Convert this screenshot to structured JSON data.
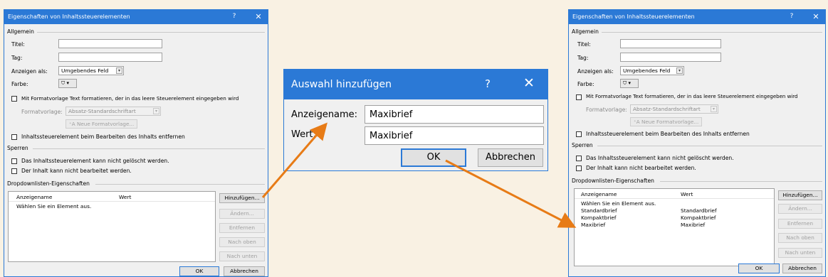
{
  "colors": {
    "background": "#f9f1e3",
    "titlebar": "#2b79d6",
    "arrow": "#e77b16"
  },
  "dialog_left": {
    "title": "Eigenschaften von Inhaltssteuerelementen",
    "help": "?",
    "close": "✕",
    "section_general": "Allgemein",
    "title_label": "Titel:",
    "tag_label": "Tag:",
    "show_as_label": "Anzeigen als:",
    "show_as_value": "Umgebendes Feld",
    "color_label": "Farbe:",
    "style_check_label": "Mit Formatvorlage Text formatieren, der in das leere Steuerelement eingegeben wird",
    "style_label": "Formatvorlage:",
    "style_value": "Absatz-Standardschriftart",
    "new_style_button": "Neue Formatvorlage...",
    "remove_check_label": "Inhaltssteuerelement beim Bearbeiten des Inhalts entfernen",
    "section_lock": "Sperren",
    "lock_delete_label": "Das Inhaltssteuerelement kann nicht gelöscht werden.",
    "lock_edit_label": "Der Inhalt kann nicht bearbeitet werden.",
    "section_dropdown": "Dropdownlisten-Eigenschaften",
    "col_display": "Anzeigename",
    "col_value": "Wert",
    "rows": [
      {
        "name": "Wählen Sie ein Element aus.",
        "value": ""
      }
    ],
    "btn_add": "Hinzufügen...",
    "btn_edit": "Ändern...",
    "btn_remove": "Entfernen",
    "btn_up": "Nach oben",
    "btn_down": "Nach unten",
    "btn_ok": "OK",
    "btn_cancel": "Abbrechen"
  },
  "dialog_middle": {
    "title": "Auswahl hinzufügen",
    "help": "?",
    "close": "✕",
    "display_name_label": "Anzeigename:",
    "display_name_value": "Maxibrief",
    "value_label": "Wert:",
    "value_value": "Maxibrief",
    "btn_ok": "OK",
    "btn_cancel": "Abbrechen"
  },
  "dialog_right": {
    "title": "Eigenschaften von Inhaltssteuerelementen",
    "help": "?",
    "close": "✕",
    "section_general": "Allgemein",
    "title_label": "Titel:",
    "tag_label": "Tag:",
    "show_as_label": "Anzeigen als:",
    "show_as_value": "Umgebendes Feld",
    "color_label": "Farbe:",
    "style_check_label": "Mit Formatvorlage Text formatieren, der in das leere Steuerelement eingegeben wird",
    "style_label": "Formatvorlage:",
    "style_value": "Absatz-Standardschriftart",
    "new_style_button": "Neue Formatvorlage...",
    "remove_check_label": "Inhaltssteuerelement beim Bearbeiten des Inhalts entfernen",
    "section_lock": "Sperren",
    "lock_delete_label": "Das Inhaltssteuerelement kann nicht gelöscht werden.",
    "lock_edit_label": "Der Inhalt kann nicht bearbeitet werden.",
    "section_dropdown": "Dropdownlisten-Eigenschaften",
    "col_display": "Anzeigename",
    "col_value": "Wert",
    "rows": [
      {
        "name": "Wählen Sie ein Element aus.",
        "value": ""
      },
      {
        "name": "Standardbrief",
        "value": "Standardbrief"
      },
      {
        "name": "Kompaktbrief",
        "value": "Kompaktbrief"
      },
      {
        "name": "Maxibrief",
        "value": "Maxibrief"
      }
    ],
    "btn_add": "Hinzufügen...",
    "btn_edit": "Ändern...",
    "btn_remove": "Entfernen",
    "btn_up": "Nach oben",
    "btn_down": "Nach unten",
    "btn_ok": "OK",
    "btn_cancel": "Abbrechen"
  }
}
